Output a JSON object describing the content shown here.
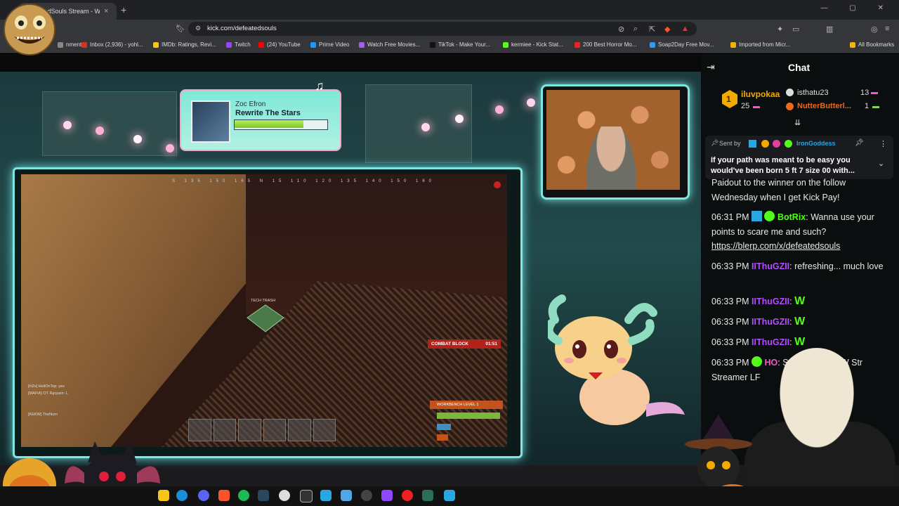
{
  "browser": {
    "tab_title": "DefeatedSouls Stream - Watc",
    "tab_close": "×",
    "new_tab": "+",
    "url": "kick.com/defeatedsouls",
    "window_controls": "— ▢ ✕",
    "bookmarks": [
      {
        "label": "nment",
        "color": "#888"
      },
      {
        "label": "Inbox (2,936) - yohl...",
        "color": "#d93025"
      },
      {
        "label": "IMDb: Ratings, Revi...",
        "color": "#f5c518"
      },
      {
        "label": "Twitch",
        "color": "#9146ff"
      },
      {
        "label": "(24) YouTube",
        "color": "#ff0000"
      },
      {
        "label": "Prime Video",
        "color": "#1a98ff"
      },
      {
        "label": "Watch Free Movies...",
        "color": "#a45cf0"
      },
      {
        "label": "TikTok - Make Your...",
        "color": "#111"
      },
      {
        "label": "kermiee - Kick Stat...",
        "color": "#53fc18"
      },
      {
        "label": "200 Best Horror Mo...",
        "color": "#e22"
      },
      {
        "label": "Soap2Day Free Mov...",
        "color": "#2a9df4"
      },
      {
        "label": "Imported from Micr...",
        "color": "#f5b400"
      },
      {
        "label": "All Bookmarks",
        "color": "#f5b400"
      }
    ]
  },
  "stream": {
    "now_playing": {
      "artist": "Zoc Efron",
      "song": "Rewrite The Stars",
      "progress": 0.75
    },
    "game_hud": {
      "compass": "S 135 150 165 N 15 110 120 135 140 150 160",
      "combat_block": "COMBAT BLOCK",
      "combat_timer": "01:51",
      "workbench": "WORKBENCH LEVEL 1",
      "tech_trash": "TECH TRASH",
      "chat_lines": [
        "[hl2s] HeliOnTop: yes",
        "[MAFIA] OT Rgcpain: L",
        "[KEKW] TheNum"
      ]
    }
  },
  "chat": {
    "title": "Chat",
    "gifters": [
      {
        "name": "iluvpokaa",
        "count": "25",
        "rank": "1"
      },
      {
        "name": "isthatu23",
        "count": "13"
      },
      {
        "name": "NutterButterl...",
        "count": "1"
      }
    ],
    "pinned": {
      "label": "Sent by",
      "sender": "IronGoddess",
      "message": "If your path was meant to be easy you would've been born 5 ft 7 size 00 with..."
    },
    "messages": [
      {
        "time": "",
        "user": "",
        "text": "Paidout to the winner on the follow Wednesday when I get Kick Pay!",
        "color": "#e8e8e8"
      },
      {
        "time": "06:31 PM",
        "user": "BotRix",
        "text": "Wanna use your points to scare me and such?",
        "link": "https://blerp.com/x/defeatedsouls",
        "color": "#53fc18"
      },
      {
        "time": "06:33 PM",
        "user": "IIThuGZII",
        "text": "refreshing... much love",
        "color": "#b44cff"
      },
      {
        "time": "06:33 PM",
        "user": "IIThuGZII",
        "text": "W",
        "color": "#b44cff"
      },
      {
        "time": "06:33 PM",
        "user": "IIThuGZII",
        "text": "W",
        "color": "#b44cff"
      },
      {
        "time": "06:33 PM",
        "user": "IIThuGZII",
        "text": "W",
        "color": "#b44cff"
      },
      {
        "time": "06:33 PM",
        "user": "HO",
        "text": "Streamer LFG W Str Streamer LF",
        "color": "#ff4fd8"
      }
    ]
  }
}
